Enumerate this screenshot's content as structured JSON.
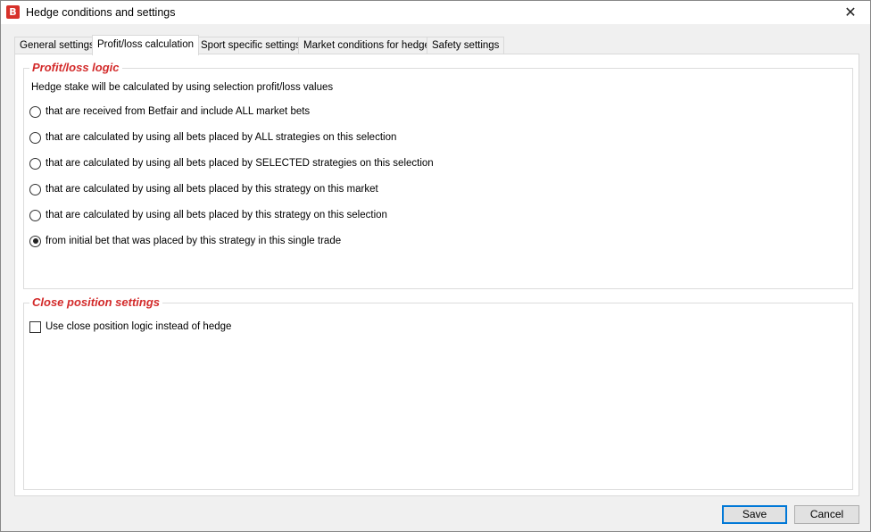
{
  "window": {
    "title": "Hedge conditions and settings",
    "app_icon_letter": "B",
    "close_glyph": "✕"
  },
  "tabs": [
    {
      "label": "General settings",
      "active": false
    },
    {
      "label": "Profit/loss calculation",
      "active": true
    },
    {
      "label": "Sport specific settings",
      "active": false
    },
    {
      "label": "Market conditions for hedge",
      "active": false
    },
    {
      "label": "Safety settings",
      "active": false
    }
  ],
  "profit_loss": {
    "title": "Profit/loss logic",
    "description": "Hedge stake will be calculated by using selection profit/loss values",
    "options": [
      {
        "label": "that are received from Betfair and include ALL market bets",
        "checked": false
      },
      {
        "label": "that are calculated by using all bets placed by ALL strategies on this selection",
        "checked": false
      },
      {
        "label": "that are calculated by using all bets placed by SELECTED strategies on this selection",
        "checked": false
      },
      {
        "label": "that are calculated by using all bets placed by this strategy on this market",
        "checked": false
      },
      {
        "label": "that are calculated by using all bets placed by this strategy on this selection",
        "checked": false
      },
      {
        "label": "from initial bet that was placed by this strategy in this single trade",
        "checked": true
      }
    ]
  },
  "close_position": {
    "title": "Close position settings",
    "checkbox_label": "Use close position logic instead of hedge",
    "checked": false
  },
  "buttons": {
    "save": "Save",
    "cancel": "Cancel"
  },
  "colors": {
    "group_title": "#d32b2b",
    "app_icon": "#d7312a",
    "default_button_border": "#0078d7"
  }
}
